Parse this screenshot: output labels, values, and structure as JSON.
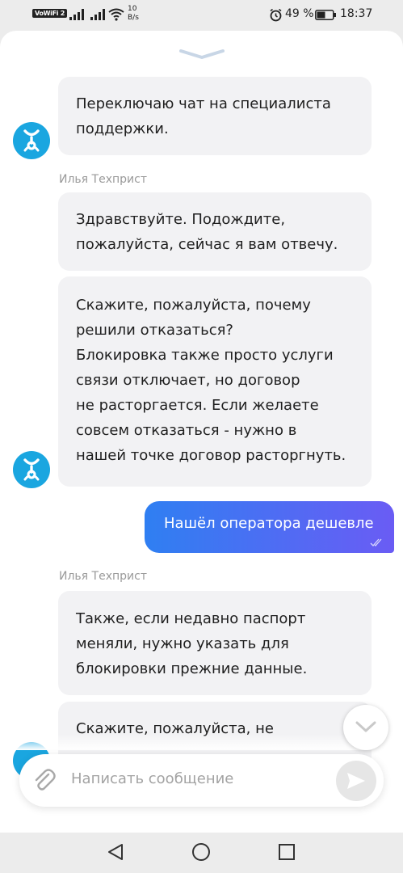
{
  "status_bar": {
    "wifi_label": "VoWiFi",
    "wifi_badge": "2",
    "speed_value": "10",
    "speed_unit": "B/s",
    "battery": "49 %",
    "time": "18:37"
  },
  "chat": {
    "messages": [
      {
        "lines": [
          "Переключаю чат на специалиста",
          "поддержки."
        ]
      },
      {
        "sender": "Илья Техприст",
        "lines": [
          "Здравствуйте. Подождите,",
          "пожалуйста, сейчас я вам отвечу."
        ]
      },
      {
        "lines": [
          "Скажите, пожалуйста, почему",
          "решили отказаться?",
          "Блокировка также просто услуги",
          "связи отключает, но договор",
          "не расторгается. Если желаете",
          "совсем отказаться - нужно в",
          "нашей точке договор расторгнуть."
        ]
      },
      {
        "sender": "Илья Техприст",
        "lines": [
          "Также, если недавно паспорт",
          "меняли, нужно указать для",
          "блокировки прежние данные."
        ]
      },
      {
        "lines": [
          "Скажите, пожалуйста, не"
        ]
      }
    ],
    "outgoing": {
      "text": "Нашёл оператора дешевле"
    }
  },
  "composer": {
    "placeholder": "Написать сообщение"
  },
  "icons": {
    "avatar": "yota-logo-icon",
    "collapse": "chevron-down-icon",
    "scroll": "chevron-down-icon",
    "attach": "paperclip-icon",
    "send": "send-icon",
    "nav_back": "triangle-back-icon",
    "nav_home": "circle-home-icon",
    "nav_recent": "square-recent-icon"
  },
  "colors": {
    "accent": "#1aa6e0",
    "bubble_in": "#f2f2f4",
    "bubble_out_start": "#2f7ff2",
    "bubble_out_end": "#6a5cf4"
  }
}
